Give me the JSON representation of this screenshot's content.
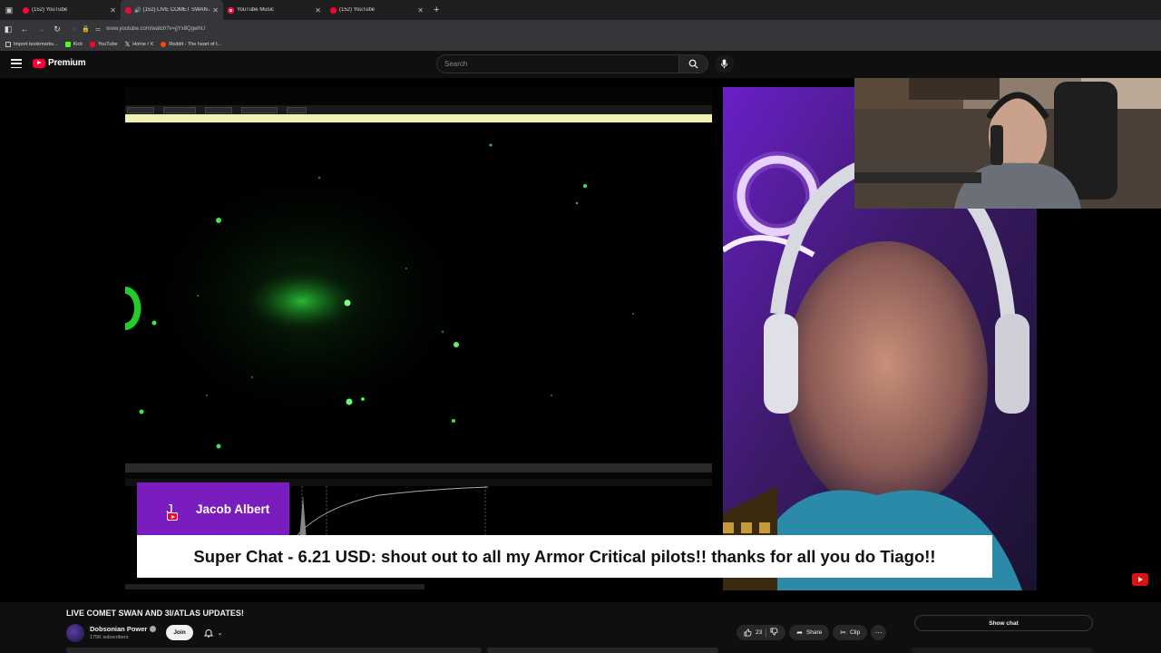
{
  "browser": {
    "tabs": [
      {
        "label": "(152) YouTube",
        "active": false,
        "audio": false
      },
      {
        "label": "(152) LIVE COMET SWAN A",
        "active": true,
        "audio": true
      },
      {
        "label": "YouTube Music",
        "active": false,
        "audio": false
      },
      {
        "label": "(152) YouTube",
        "active": false,
        "audio": false
      }
    ],
    "url": "www.youtube.com/watch?v=jjYx8QgwhU",
    "bookmarks": [
      {
        "label": "Import bookmarks...",
        "icon": "import-icon",
        "color": "#cccccc"
      },
      {
        "label": "Kick",
        "icon": "kick-icon",
        "color": "#53fc18"
      },
      {
        "label": "YouTube",
        "icon": "youtube-icon",
        "color": "#ff0033"
      },
      {
        "label": "Home / X",
        "icon": "x-icon",
        "color": "#ffffff"
      },
      {
        "label": "Reddit - The heart of t...",
        "icon": "reddit-icon",
        "color": "#ff4500"
      }
    ]
  },
  "header": {
    "logo_text": "Premium",
    "search_placeholder": "Search"
  },
  "player": {
    "superchat_name": "Jacob Albert",
    "superchat_initial": "J",
    "superchat_message": "Super Chat - 6.21 USD: shout out to all my Armor Critical pilots!! thanks for all you do Tiago!!",
    "accent_color": "#7a1dbf"
  },
  "video": {
    "title": "LIVE COMET SWAN AND 3I/ATLAS UPDATES!",
    "channel": "Dobsonian Power",
    "subscribers": "175K subscribers",
    "join_label": "Join",
    "like_count": "23",
    "share_label": "Share",
    "clip_label": "Clip",
    "show_chat_label": "Show chat"
  }
}
